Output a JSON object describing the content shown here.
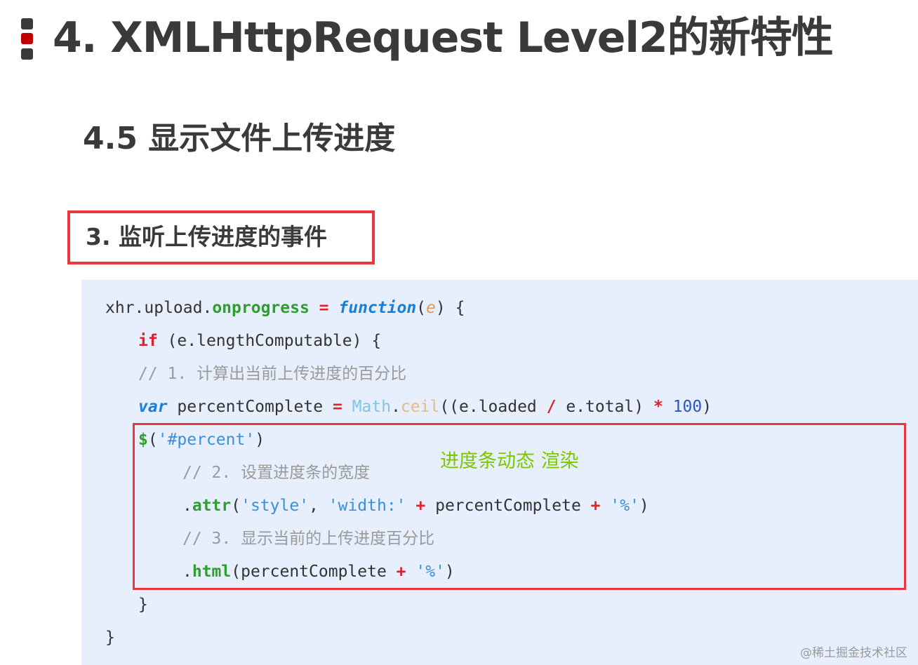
{
  "header": {
    "title": "4. XMLHttpRequest Level2的新特性",
    "bullet_colors": [
      "#3a3a3a",
      "#c00000",
      "#3a3a3a"
    ]
  },
  "section": {
    "title": "4.5 显示文件上传进度"
  },
  "step": {
    "title": "3. 监听上传进度的事件",
    "border_color": "#e8373f"
  },
  "code": {
    "line1": {
      "obj": "xhr.upload.",
      "prop": "onprogress",
      "sp1": " ",
      "eq": "=",
      "sp2": " ",
      "kw": "function",
      "open": "(",
      "param": "e",
      "close": ") {"
    },
    "line2": {
      "kw": "if",
      "rest": " (e.lengthComputable) {"
    },
    "line3": {
      "comment": "// 1. 计算出当前上传进度的百分比"
    },
    "line4": {
      "kw": "var",
      "a": " percentComplete ",
      "eq": "=",
      "sp": " ",
      "math": "Math",
      "dot": ".",
      "ceil": "ceil",
      "b": "((e.loaded ",
      "div": "/",
      "c": " e.total) ",
      "mul": "*",
      "sp2": " ",
      "num": "100",
      "d": ")"
    },
    "line5": {
      "dollar": "$",
      "open": "(",
      "str": "'#percent'",
      "close": ")"
    },
    "line6": {
      "comment": "// 2. 设置进度条的宽度"
    },
    "line7": {
      "dot": ".",
      "method": "attr",
      "open": "(",
      "s1": "'style'",
      "comma": ", ",
      "s2": "'width:'",
      "sp": " ",
      "plus1": "+",
      "mid": " percentComplete ",
      "plus2": "+",
      "sp2": " ",
      "s3": "'%'",
      "close": ")"
    },
    "line8": {
      "comment": "// 3. 显示当前的上传进度百分比"
    },
    "line9": {
      "dot": ".",
      "method": "html",
      "mid": "(percentComplete ",
      "plus": "+",
      "sp": " ",
      "s": "'%'",
      "close": ")"
    },
    "line10": {
      "text": "}"
    },
    "line11": {
      "text": "}"
    }
  },
  "annotation": {
    "text": "进度条动态 渲染",
    "color": "#7cc700"
  },
  "watermark": {
    "text": "@稀土掘金技术社区"
  }
}
